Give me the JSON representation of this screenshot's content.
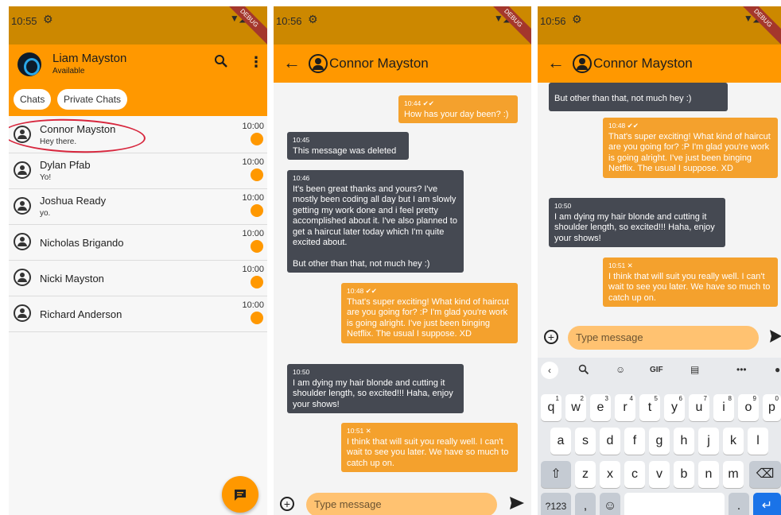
{
  "screen1": {
    "status_time": "10:55",
    "debug_label": "DEBUG",
    "header": {
      "title": "Liam Mayston",
      "subtitle": "Available"
    },
    "tabs": [
      "Chats",
      "Private Chats"
    ],
    "chats": [
      {
        "name": "Connor Mayston",
        "message": "Hey there.",
        "time": "10:00"
      },
      {
        "name": "Dylan Pfab",
        "message": "Yo!",
        "time": "10:00"
      },
      {
        "name": "Joshua Ready",
        "message": "yo.",
        "time": "10:00"
      },
      {
        "name": "Nicholas Brigando",
        "message": "",
        "time": "10:00"
      },
      {
        "name": "Nicki Mayston",
        "message": "",
        "time": "10:00"
      },
      {
        "name": "Richard Anderson",
        "message": "",
        "time": "10:00"
      }
    ],
    "accent_color": "#ff9800",
    "highlight_color": "#d7263d"
  },
  "screen2": {
    "status_time": "10:56",
    "debug_label": "DEBUG",
    "title": "Connor Mayston",
    "composer_placeholder": "Type message",
    "messages": [
      {
        "direction": "out",
        "time": "10:44",
        "status": "✔✔",
        "text": "How has your day been? :)"
      },
      {
        "direction": "in",
        "time": "10:45",
        "text": "This message was deleted"
      },
      {
        "direction": "in",
        "time": "10:46",
        "text": "It's been great thanks and yours? I've mostly been coding all day but I am slowly getting my work done and i feel pretty accomplished about it. I've also planned to get a haircut later today which I'm quite excited about.\n\nBut other than that, not much hey :)"
      },
      {
        "direction": "out",
        "time": "10:48",
        "status": "✔✔",
        "text": "That's super exciting! What kind of haircut are you going for? :P I'm glad you're work is going alright. I've just been binging Netflix. The usual I suppose. XD"
      },
      {
        "direction": "in",
        "time": "10:50",
        "text": "I am dying my hair blonde and cutting it shoulder length, so excited!!! Haha, enjoy your shows!"
      },
      {
        "direction": "out",
        "time": "10:51",
        "status": "✕",
        "text": "I think that will suit you really well. I can't wait to see you later. We have so much to catch up on."
      }
    ]
  },
  "screen3": {
    "status_time": "10:56",
    "debug_label": "DEBUG",
    "title": "Connor Mayston",
    "composer_placeholder": "Type message",
    "messages": [
      {
        "direction": "in",
        "text": "But other than that, not much hey :)"
      },
      {
        "direction": "out",
        "time": "10:48",
        "status": "✔✔",
        "text": "That's super exciting! What kind of haircut are you going for? :P I'm glad you're work is going alright. I've just been binging Netflix. The usual I suppose. XD"
      },
      {
        "direction": "in",
        "time": "10:50",
        "text": "I am dying my hair blonde and cutting it shoulder length, so excited!!! Haha, enjoy your shows!"
      },
      {
        "direction": "out",
        "time": "10:51",
        "status": "✕",
        "text": "I think that will suit you really well. I can't wait to see you later. We have so much to catch up on."
      }
    ],
    "keyboard": {
      "toolbar": [
        "GIF"
      ],
      "row1": [
        "q",
        "w",
        "e",
        "r",
        "t",
        "y",
        "u",
        "i",
        "o",
        "p"
      ],
      "row1_hints": [
        "1",
        "2",
        "3",
        "4",
        "5",
        "6",
        "7",
        "8",
        "9",
        "0"
      ],
      "row2": [
        "a",
        "s",
        "d",
        "f",
        "g",
        "h",
        "j",
        "k",
        "l"
      ],
      "row3": [
        "z",
        "x",
        "c",
        "v",
        "b",
        "n",
        "m"
      ],
      "symbols_key": "?123",
      "comma_key": ",",
      "period_key": "."
    }
  },
  "icons": {
    "back": "arrow-left-icon",
    "search": "search-icon",
    "more": "more-vert-icon",
    "send": "send-icon",
    "add": "add-circle-icon",
    "fab": "message-icon"
  }
}
